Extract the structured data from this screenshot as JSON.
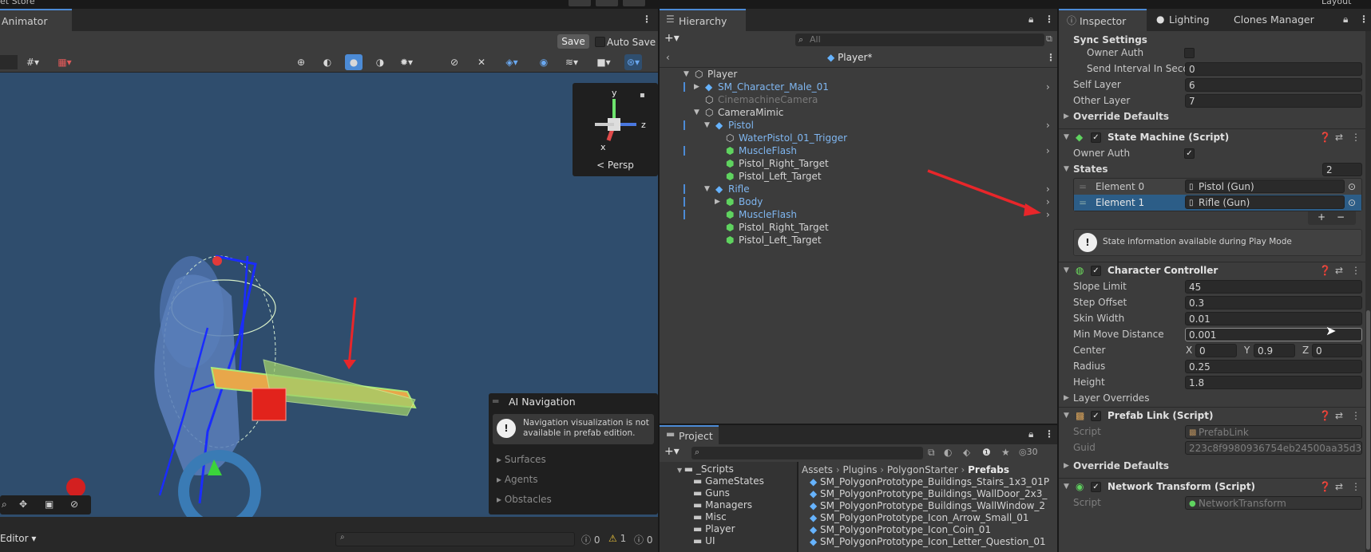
{
  "top_strip": {
    "asset_store_label": "et Store",
    "layout_label": "Layout"
  },
  "animator": {
    "tab_label": "Animator",
    "save_label": "Save",
    "auto_save_label": "Auto Save",
    "persp_label": "< Persp",
    "gizmo_axes": {
      "y": "y",
      "z": "z",
      "x": "x"
    },
    "ai_nav": {
      "title": "AI Navigation",
      "message": "Navigation visualization is not available in prefab edition.",
      "sections": [
        "Surfaces",
        "Agents",
        "Obstacles"
      ]
    },
    "bottom_bar": {
      "editor_label": "Editor",
      "counts": {
        "info": "0",
        "warn": "1",
        "error": "0"
      }
    }
  },
  "hierarchy": {
    "tab_label": "Hierarchy",
    "search_placeholder": "All",
    "prefab_title": "Player*",
    "rows": [
      {
        "label": "Player",
        "indent": 0,
        "fold": "▼",
        "style": "normal",
        "icon": "cube-outline-icon"
      },
      {
        "label": "SM_Character_Male_01",
        "indent": 1,
        "fold": "▶",
        "style": "blue",
        "icon": "prefab-cube-icon"
      },
      {
        "label": "CinemachineCamera",
        "indent": 1,
        "fold": "",
        "style": "dim",
        "icon": "cube-outline-icon"
      },
      {
        "label": "CameraMimic",
        "indent": 1,
        "fold": "▼",
        "style": "normal",
        "icon": "cube-outline-icon"
      },
      {
        "label": "Pistol",
        "indent": 2,
        "fold": "▼",
        "style": "blue",
        "icon": "prefab-cube-icon"
      },
      {
        "label": "WaterPistol_01_Trigger",
        "indent": 3,
        "fold": "",
        "style": "blue",
        "icon": "cube-outline-icon"
      },
      {
        "label": "MuscleFlash",
        "indent": 3,
        "fold": "",
        "style": "blue",
        "icon": "prefab-variant-icon"
      },
      {
        "label": "Pistol_Right_Target",
        "indent": 3,
        "fold": "",
        "style": "normal",
        "icon": "prefab-variant-icon"
      },
      {
        "label": "Pistol_Left_Target",
        "indent": 3,
        "fold": "",
        "style": "normal",
        "icon": "prefab-variant-icon"
      },
      {
        "label": "Rifle",
        "indent": 2,
        "fold": "▼",
        "style": "blue",
        "icon": "prefab-cube-icon"
      },
      {
        "label": "Body",
        "indent": 3,
        "fold": "▶",
        "style": "blue",
        "icon": "prefab-variant-icon"
      },
      {
        "label": "MuscleFlash",
        "indent": 3,
        "fold": "",
        "style": "blue",
        "icon": "prefab-variant-icon"
      },
      {
        "label": "Pistol_Right_Target",
        "indent": 3,
        "fold": "",
        "style": "normal",
        "icon": "prefab-variant-icon"
      },
      {
        "label": "Pistol_Left_Target",
        "indent": 3,
        "fold": "",
        "style": "normal",
        "icon": "prefab-variant-icon"
      }
    ]
  },
  "project": {
    "tab_label": "Project",
    "hidden_count": "30",
    "breadcrumb": [
      "Assets",
      "Plugins",
      "PolygonStarter",
      "Prefabs"
    ],
    "folders": [
      "_Scripts",
      "GameStates",
      "Guns",
      "Managers",
      "Misc",
      "Player",
      "UI"
    ],
    "files": [
      "SM_PolygonPrototype_Buildings_Stairs_1x3_01P",
      "SM_PolygonPrototype_Buildings_WallDoor_2x3_",
      "SM_PolygonPrototype_Buildings_WallWindow_2",
      "SM_PolygonPrototype_Icon_Arrow_Small_01",
      "SM_PolygonPrototype_Icon_Coin_01",
      "SM_PolygonPrototype_Icon_Letter_Question_01"
    ]
  },
  "inspector": {
    "tabs": [
      "Inspector",
      "Lighting",
      "Clones Manager"
    ],
    "sync_settings": {
      "title": "Sync Settings",
      "owner_auth_label": "Owner Auth",
      "send_interval_label": "Send Interval In Seco",
      "send_interval_value": "0"
    },
    "self_layer": {
      "label": "Self Layer",
      "value": "6"
    },
    "other_layer": {
      "label": "Other Layer",
      "value": "7"
    },
    "override_defaults_1": "Override Defaults",
    "state_machine": {
      "title": "State Machine (Script)",
      "owner_auth_label": "Owner Auth",
      "owner_auth_checked": "✓",
      "states_label": "States",
      "states_count": "2",
      "elements": [
        {
          "label": "Element 0",
          "value": "Pistol (Gun)"
        },
        {
          "label": "Element 1",
          "value": "Rifle (Gun)"
        }
      ],
      "info": "State information available during Play Mode"
    },
    "character_controller": {
      "title": "Character Controller",
      "slope_limit": {
        "label": "Slope Limit",
        "value": "45"
      },
      "step_offset": {
        "label": "Step Offset",
        "value": "0.3"
      },
      "skin_width": {
        "label": "Skin Width",
        "value": "0.01"
      },
      "min_move": {
        "label": "Min Move Distance",
        "value": "0.001"
      },
      "center": {
        "label": "Center",
        "x": "0",
        "y": "0.9",
        "z": "0"
      },
      "radius": {
        "label": "Radius",
        "value": "0.25"
      },
      "height": {
        "label": "Height",
        "value": "1.8"
      },
      "layer_overrides": "Layer Overrides"
    },
    "prefab_link": {
      "title": "Prefab Link (Script)",
      "script_label": "Script",
      "script_value": "PrefabLink",
      "guid_label": "Guid",
      "guid_value": "223c8f9980936754eb24500aa35d3"
    },
    "override_defaults_2": "Override Defaults",
    "network_transform": {
      "title": "Network Transform (Script)",
      "script_label": "Script",
      "script_value": "NetworkTransform"
    }
  },
  "colors": {
    "accent": "#4c8bd6",
    "selection": "#2c5d87",
    "arrow": "#e8262a"
  }
}
